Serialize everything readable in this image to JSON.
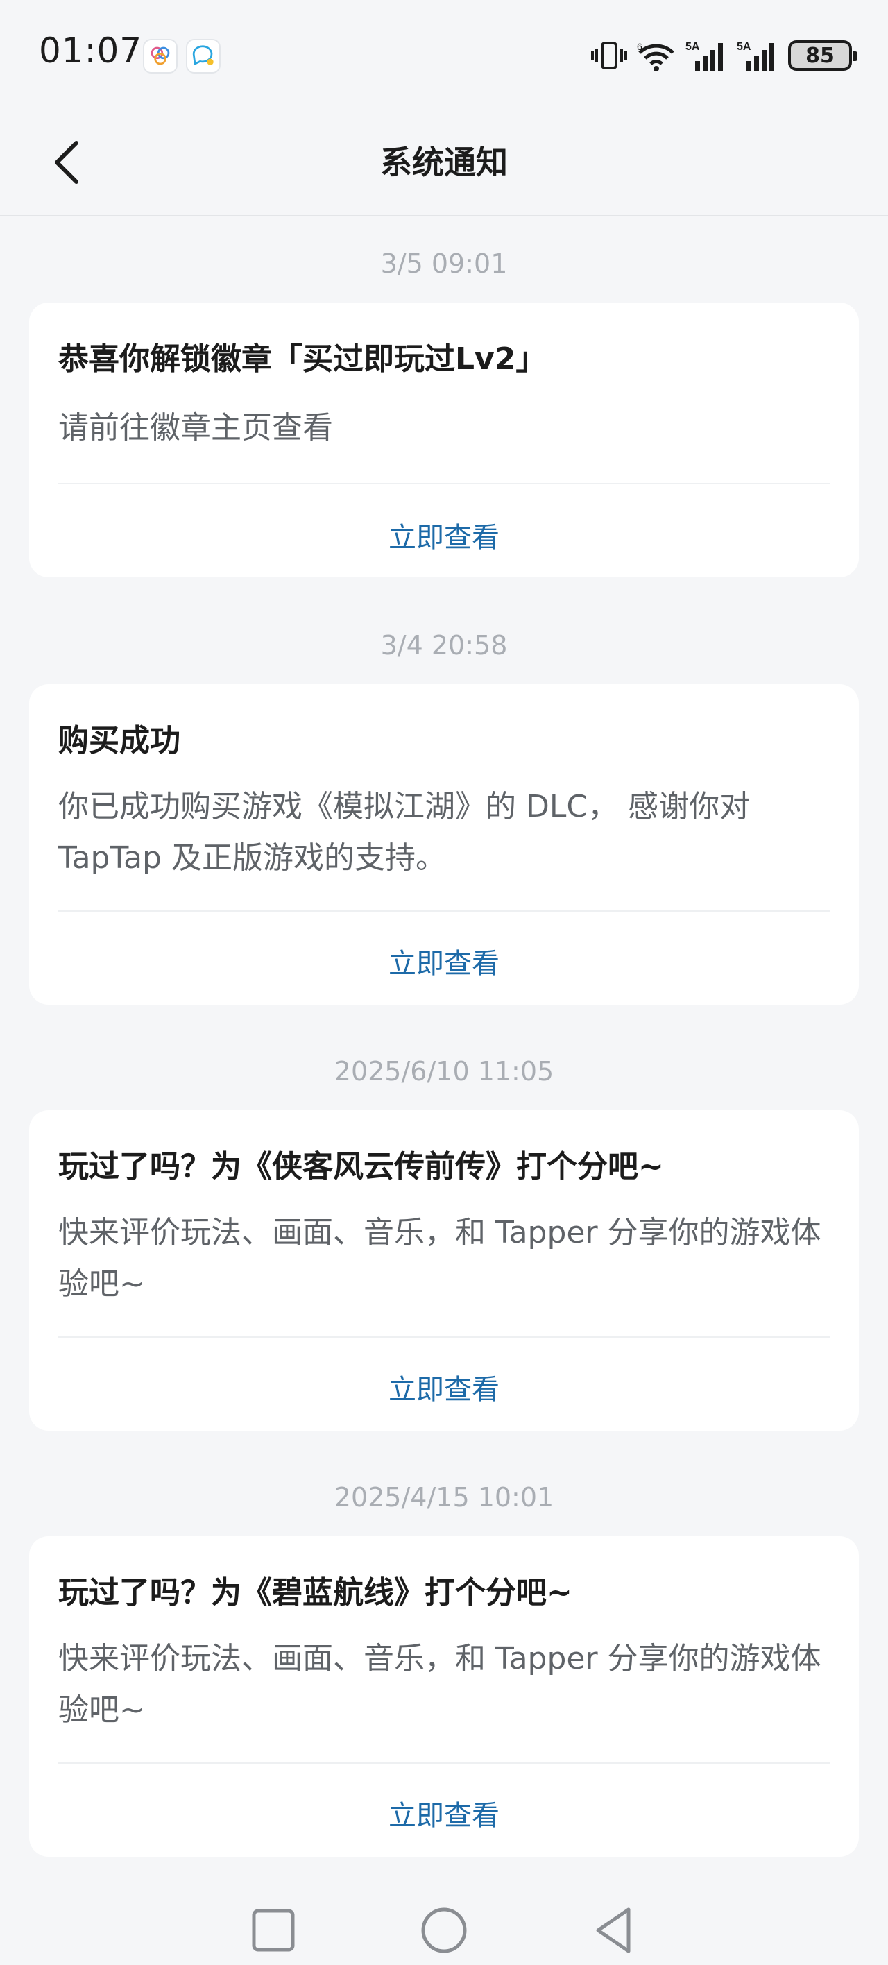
{
  "status_bar": {
    "time": "01:07",
    "battery": "85",
    "network_1": "5A",
    "network_2": "5A",
    "wifi_badge": "6"
  },
  "header": {
    "title": "系统通知"
  },
  "notifications": [
    {
      "timestamp": "3/5  09:01",
      "title": "恭喜你解锁徽章「买过即玩过Lv2」",
      "body": "请前往徽章主页查看",
      "action": "立即查看"
    },
    {
      "timestamp": "3/4  20:58",
      "title": "购买成功",
      "body": "你已成功购买游戏《模拟江湖》的 DLC， 感谢你对 TapTap 及正版游戏的支持。",
      "action": "立即查看"
    },
    {
      "timestamp": "2025/6/10  11:05",
      "title": "玩过了吗？为《侠客风云传前传》打个分吧~",
      "body": "快来评价玩法、画面、音乐，和 Tapper 分享你的游戏体验吧~",
      "action": "立即查看"
    },
    {
      "timestamp": "2025/4/15  10:01",
      "title": "玩过了吗？为《碧蓝航线》打个分吧~",
      "body": "快来评价玩法、画面、音乐，和 Tapper 分享你的游戏体验吧~",
      "action": "立即查看"
    }
  ],
  "colors": {
    "background": "#f5f6f8",
    "card": "#ffffff",
    "accent": "#1d6aa8",
    "title_text": "#1c1c1c",
    "body_text": "#5f6368",
    "timestamp_text": "#a9adb3"
  }
}
